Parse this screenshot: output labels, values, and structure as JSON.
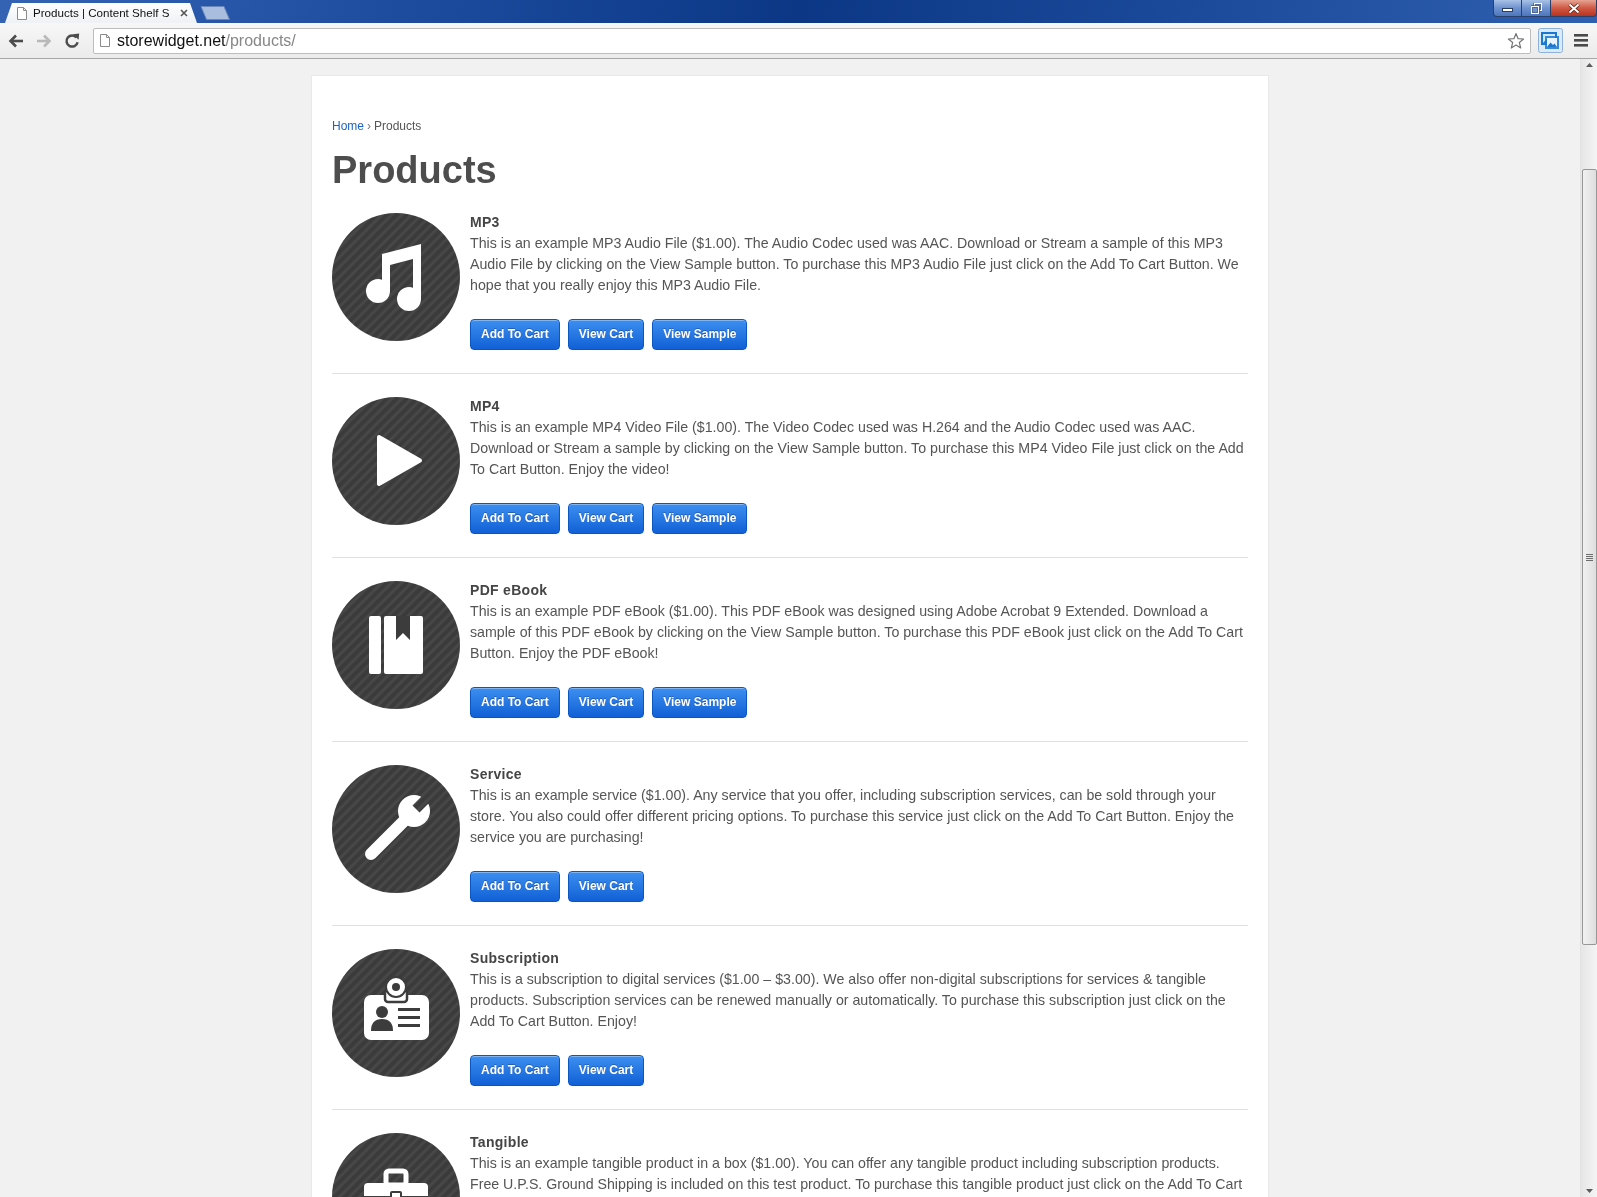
{
  "browser": {
    "tab": {
      "title": "Products | Content Shelf S"
    },
    "nav": [
      {
        "kind": "back",
        "disabled": false
      },
      {
        "kind": "forward",
        "disabled": true
      },
      {
        "kind": "reload",
        "disabled": false
      }
    ],
    "address": {
      "host": "storewidget.net",
      "path": "/products/"
    }
  },
  "breadcrumb": {
    "items": [
      {
        "label": "Home",
        "kind": "link"
      },
      {
        "label": "Products",
        "kind": "current"
      }
    ],
    "separator": "›"
  },
  "page_title": "Products",
  "products": [
    {
      "kind": "music",
      "title": "MP3",
      "description": "This is an example MP3 Audio File ($1.00). The Audio Codec used was AAC. Download or Stream a sample of this MP3 Audio File by clicking on the View Sample button. To purchase this MP3 Audio File just click on the Add To Cart Button. We hope that you really enjoy this MP3 Audio File.",
      "buttons": [
        "Add To Cart",
        "View Cart",
        "View Sample"
      ]
    },
    {
      "kind": "play",
      "title": "MP4",
      "description": "This is an example MP4 Video File ($1.00). The Video Codec used was H.264 and the Audio Codec used was AAC. Download or Stream a sample by clicking on the View Sample button. To purchase this MP4 Video File just click on the Add To Cart Button. Enjoy the video!",
      "buttons": [
        "Add To Cart",
        "View Cart",
        "View Sample"
      ]
    },
    {
      "kind": "book",
      "title": "PDF eBook",
      "description": "This is an example PDF eBook ($1.00). This PDF eBook was designed using Adobe Acrobat 9 Extended. Download a sample of this PDF eBook by clicking on the View Sample button. To purchase this PDF eBook just click on the Add To Cart Button. Enjoy the PDF eBook!",
      "buttons": [
        "Add To Cart",
        "View Cart",
        "View Sample"
      ]
    },
    {
      "kind": "wrench",
      "title": "Service",
      "description": "This is an example service ($1.00). Any service that you offer, including subscription services, can be sold through your store. You also could offer different pricing options. To purchase this service just click on the Add To Cart Button. Enjoy the service you are purchasing!",
      "buttons": [
        "Add To Cart",
        "View Cart"
      ]
    },
    {
      "kind": "badge",
      "title": "Subscription",
      "description": "This is a subscription to digital services ($1.00 – $3.00). We also offer non-digital subscriptions for services & tangible products. Subscription services can be renewed manually or automatically. To purchase this subscription just click on the Add To Cart Button. Enjoy!",
      "buttons": [
        "Add To Cart",
        "View Cart"
      ]
    },
    {
      "kind": "toolbox",
      "title": "Tangible",
      "description": "This is an example tangible product in a box ($1.00). You can offer any tangible product including subscription products. Free U.P.S. Ground Shipping is included on this test product. To purchase this tangible product just click on the Add To Cart"
    }
  ]
}
